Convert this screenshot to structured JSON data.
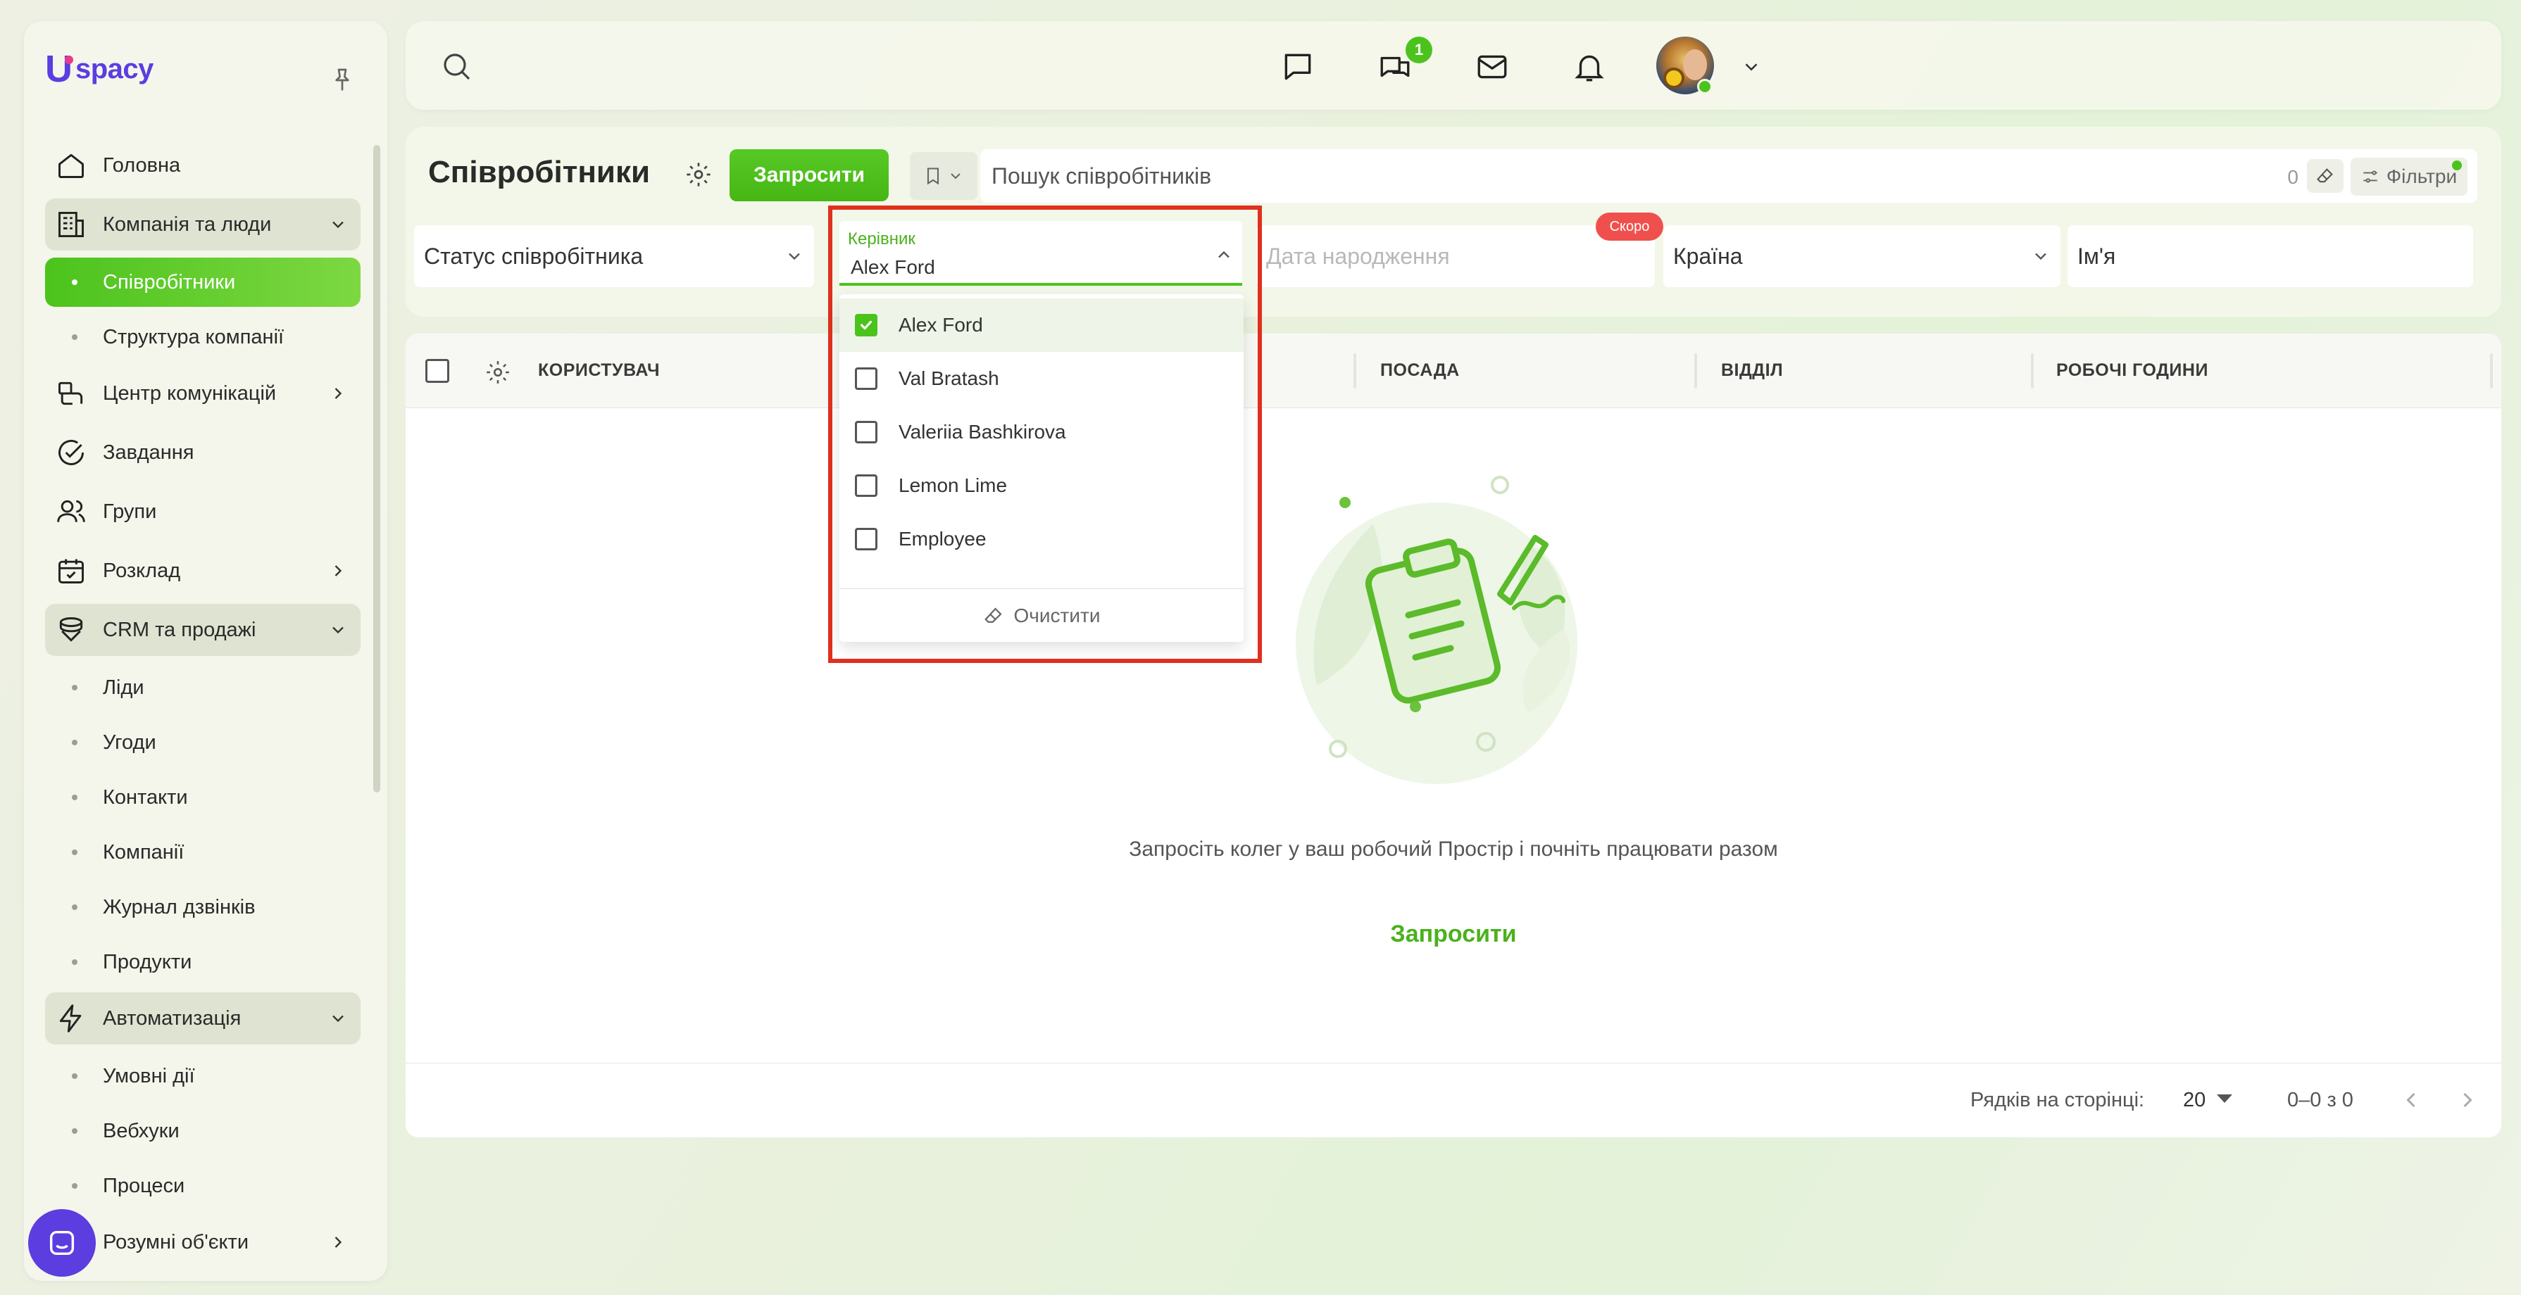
{
  "app": {
    "logo_text": "spacy"
  },
  "sidebar": {
    "items": [
      {
        "label": "Головна",
        "icon": "home-icon"
      },
      {
        "label": "Компанія та люди",
        "icon": "building-icon",
        "expanded": true
      },
      {
        "label": "Співробітники",
        "sub": true,
        "active": true
      },
      {
        "label": "Структура компанії",
        "sub": true
      },
      {
        "label": "Центр комунікацій",
        "icon": "communication-icon"
      },
      {
        "label": "Завдання",
        "icon": "task-check-icon"
      },
      {
        "label": "Групи",
        "icon": "users-icon"
      },
      {
        "label": "Розклад",
        "icon": "calendar-icon"
      },
      {
        "label": "CRM та продажі",
        "icon": "crm-stack-icon",
        "expanded": true
      },
      {
        "label": "Ліди",
        "sub": true
      },
      {
        "label": "Угоди",
        "sub": true
      },
      {
        "label": "Контакти",
        "sub": true
      },
      {
        "label": "Компанії",
        "sub": true
      },
      {
        "label": "Журнал дзвінків",
        "sub": true
      },
      {
        "label": "Продукти",
        "sub": true
      },
      {
        "label": "Автоматизація",
        "icon": "lightning-icon",
        "expanded": true
      },
      {
        "label": "Умовні дії",
        "sub": true
      },
      {
        "label": "Вебхуки",
        "sub": true
      },
      {
        "label": "Процеси",
        "sub": true
      },
      {
        "label": "Розумні об'єкти",
        "icon": "smart-objects-icon"
      }
    ]
  },
  "topbar": {
    "chat_badge": "1"
  },
  "header": {
    "title": "Співробітники",
    "invite_label": "Запросити",
    "search_placeholder": "Пошук співробітників",
    "search_count": "0",
    "filters_label": "Фільтри"
  },
  "filters": {
    "status_label": "Статус співробітника",
    "birthdate_placeholder": "Дата народження",
    "soon_badge": "Скоро",
    "country_label": "Країна",
    "name_label": "Ім'я"
  },
  "manager_dropdown": {
    "field_label": "Керівник",
    "field_value": "Alex Ford",
    "options": [
      {
        "label": "Alex Ford",
        "checked": true
      },
      {
        "label": "Val Bratash",
        "checked": false
      },
      {
        "label": "Valeriia Bashkirova",
        "checked": false
      },
      {
        "label": "Lemon Lime",
        "checked": false
      },
      {
        "label": "Employee",
        "checked": false
      }
    ],
    "clear_label": "Очистити"
  },
  "table": {
    "columns": [
      "КОРИСТУВАЧ",
      "ПОСАДА",
      "ВІДДІЛ",
      "РОБОЧІ ГОДИНИ"
    ],
    "empty_text": "Запросіть колег у ваш робочий Простір і почніть працювати разом",
    "empty_invite": "Запросити",
    "rows_per_page_label": "Рядків на сторінці:",
    "rows_per_page_value": "20",
    "range_text": "0–0 з 0"
  },
  "colors": {
    "accent": "#4cc31d",
    "brand": "#5b3de0",
    "highlight": "#e0301e",
    "soon": "#f0504d"
  }
}
